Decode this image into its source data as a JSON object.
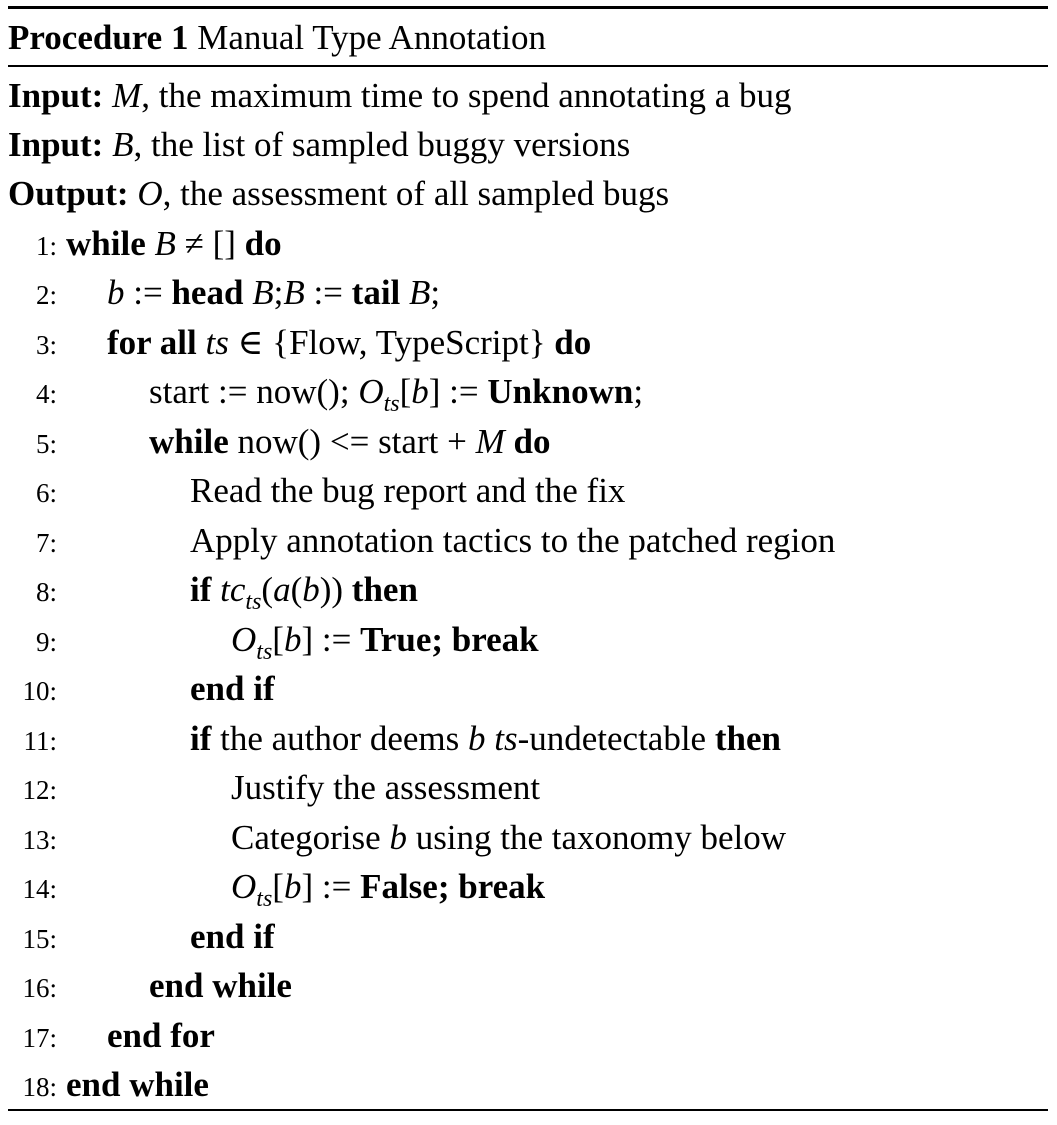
{
  "header": {
    "label": "Procedure 1",
    "title": "Manual Type Annotation"
  },
  "io": [
    {
      "kind": "Input:",
      "var": "M",
      "text": ", the maximum time to spend annotating a bug"
    },
    {
      "kind": "Input:",
      "var": "B",
      "text": ", the list of sampled buggy versions"
    },
    {
      "kind": "Output:",
      "var": "O",
      "text": ", the assessment of all sampled bugs"
    }
  ],
  "lines": [
    {
      "num": "1:"
    },
    {
      "num": "2:"
    },
    {
      "num": "3:"
    },
    {
      "num": "4:"
    },
    {
      "num": "5:"
    },
    {
      "num": "6:",
      "text": "Read the bug report and the fix"
    },
    {
      "num": "7:",
      "text": "Apply annotation tactics to the patched region"
    },
    {
      "num": "8:"
    },
    {
      "num": "9:"
    },
    {
      "num": "10:"
    },
    {
      "num": "11:"
    },
    {
      "num": "12:",
      "text": "Justify the assessment"
    },
    {
      "num": "13:"
    },
    {
      "num": "14:"
    },
    {
      "num": "15:"
    },
    {
      "num": "16:"
    },
    {
      "num": "17:"
    },
    {
      "num": "18:"
    }
  ],
  "tokens": {
    "while": "while",
    "do": "do",
    "end_while": "end while",
    "end_for": "end for",
    "end_if": "end if",
    "for_all": "for all",
    "if": "if",
    "then": "then",
    "head": "head",
    "tail": "tail",
    "break": "break",
    "unknown": "Unknown",
    "true": "True",
    "false": "False",
    "start": "start",
    "now": "now()",
    "ts": "ts",
    "tc": "tc",
    "b": "b",
    "B": "B",
    "M": "M",
    "O": "O",
    "a": "a",
    "assign": " := ",
    "neq": " ≠ [] ",
    "in": " ∈ ",
    "set": "{Flow, TypeScript}",
    "le": " <= ",
    "plus": " + ",
    "author_pre": "the author deems ",
    "undetectable": "-undetectable",
    "categorise_pre": "Categorise ",
    "categorise_post": " using the taxonomy below"
  }
}
